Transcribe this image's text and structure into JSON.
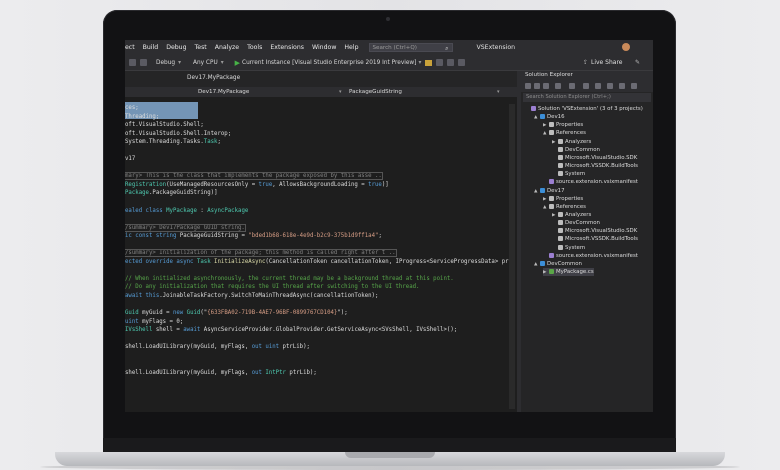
{
  "menu": {
    "items": [
      "ect",
      "Build",
      "Debug",
      "Test",
      "Analyze",
      "Tools",
      "Extensions",
      "Window",
      "Help"
    ],
    "search_placeholder": "Search (Ctrl+Q)",
    "solution_name": "VSExtension"
  },
  "toolbar": {
    "config": "Debug",
    "platform": "Any CPU",
    "run_target": "Current Instance [Visual Studio Enterprise 2019 Int Preview]",
    "live_share": "Live Share"
  },
  "editor": {
    "tab": "Dev17.MyPackage",
    "nav_member": "PackageGuidString",
    "lines": [
      [
        [
          "ces;",
          "id"
        ]
      ],
      [
        [
          "Threading;",
          "id"
        ]
      ],
      [
        [
          "oft.VisualStudio.Shell;",
          "id"
        ]
      ],
      [
        [
          "oft.VisualStudio.Shell.Interop;",
          "id"
        ]
      ],
      [
        [
          "System.Threading.Tasks.",
          "id"
        ],
        [
          "Task",
          "ty"
        ],
        [
          ";",
          "id"
        ]
      ],
      [
        [
          "",
          "id"
        ]
      ],
      [
        [
          "v17",
          "id"
        ]
      ],
      [
        [
          "",
          "id"
        ]
      ],
      [
        [
          "mary> This is the class that implements the package exposed by this asse ..",
          "cs"
        ]
      ],
      [
        [
          "Registration",
          "ty"
        ],
        [
          "(UseManagedResourcesOnly = ",
          "id"
        ],
        [
          "true",
          "kw"
        ],
        [
          ", AllowsBackgroundLoading = ",
          "id"
        ],
        [
          "true",
          "kw"
        ],
        [
          ")]",
          "id"
        ]
      ],
      [
        [
          "Package",
          "ty"
        ],
        [
          ".",
          "id"
        ],
        [
          "PackageGuidString",
          "id"
        ],
        [
          ")]",
          "id"
        ]
      ],
      [
        [
          "",
          "id"
        ]
      ],
      [
        [
          "ealed class ",
          "kw"
        ],
        [
          "MyPackage",
          "ty"
        ],
        [
          " : ",
          "id"
        ],
        [
          "AsyncPackage",
          "ty"
        ]
      ],
      [
        [
          "",
          "id"
        ]
      ],
      [
        [
          "/summary> Dev17Package GUID string.",
          "cs"
        ]
      ],
      [
        [
          "ic const ",
          "kw"
        ],
        [
          "string ",
          "kw"
        ],
        [
          "PackageGuidString",
          "id"
        ],
        [
          " = ",
          "id"
        ],
        [
          "\"bded1b68-618e-4e9d-b2c9-375b1d9ff1a4\"",
          "st"
        ],
        [
          ";",
          "id"
        ]
      ],
      [
        [
          "",
          "id"
        ]
      ],
      [
        [
          "/summary> Initialization of the package; this method is called right after t ..",
          "cs"
        ]
      ],
      [
        [
          "ected override async ",
          "kw"
        ],
        [
          "Task ",
          "ty"
        ],
        [
          "InitializeAsync",
          "fn"
        ],
        [
          "(CancellationToken cancellationToken, IProgress<ServiceProgressData> pr",
          "id"
        ]
      ],
      [
        [
          "",
          "id"
        ]
      ],
      [
        [
          "// When initialized asynchronously, the current thread may be a background thread at this point.",
          "cm"
        ]
      ],
      [
        [
          "// Do any initialization that requires the UI thread after switching to the UI thread.",
          "cm"
        ]
      ],
      [
        [
          "await ",
          "kw"
        ],
        [
          "this",
          "kw"
        ],
        [
          ".JoinableTaskFactory.SwitchToMainThreadAsync(cancellationToken);",
          "id"
        ]
      ],
      [
        [
          "",
          "id"
        ]
      ],
      [
        [
          "Guid ",
          "ty"
        ],
        [
          "myGuid = ",
          "id"
        ],
        [
          "new ",
          "kw"
        ],
        [
          "Guid",
          "ty"
        ],
        [
          "(\"",
          "id"
        ],
        [
          "{633FBA02-719B-4AE7-96BF-0899767CD104}",
          "st"
        ],
        [
          "\");",
          "id"
        ]
      ],
      [
        [
          "uint ",
          "kw"
        ],
        [
          "myFlags = 0;",
          "id"
        ]
      ],
      [
        [
          "IVsShell ",
          "ty"
        ],
        [
          "shell = ",
          "id"
        ],
        [
          "await ",
          "kw"
        ],
        [
          "AsyncServiceProvider.GlobalProvider.GetServiceAsync<SVsShell, IVsShell>();",
          "id"
        ]
      ],
      [
        [
          "",
          "id"
        ]
      ],
      [
        [
          "shell.LoadUILibrary(myGuid, myFlags, ",
          "id"
        ],
        [
          "out ",
          "kw"
        ],
        [
          "uint ",
          "kw"
        ],
        [
          "ptrLib);",
          "id"
        ]
      ],
      [
        [
          "",
          "id"
        ]
      ],
      [
        [
          "",
          "id"
        ]
      ],
      [
        [
          "shell.LoadUILibrary(myGuid, myFlags, ",
          "id"
        ],
        [
          "out ",
          "kw"
        ],
        [
          "IntPtr ",
          "ty"
        ],
        [
          "ptrLib);",
          "id"
        ]
      ]
    ]
  },
  "solution_explorer": {
    "title": "Solution Explorer",
    "search_placeholder": "Search Solution Explorer (Ctrl+;)",
    "nodes": [
      {
        "label": "Solution 'VSExtension' (3 of 3 projects)",
        "indent": 0,
        "arrow": "",
        "icon": "#9b7fd1"
      },
      {
        "label": "Dev16",
        "indent": 1,
        "arrow": "▲",
        "icon": "#3c8fd8"
      },
      {
        "label": "Properties",
        "indent": 2,
        "arrow": "▶",
        "icon": "#bdbdbd"
      },
      {
        "label": "References",
        "indent": 2,
        "arrow": "▲",
        "icon": "#bdbdbd"
      },
      {
        "label": "Analyzers",
        "indent": 3,
        "arrow": "▶",
        "icon": "#bdbdbd"
      },
      {
        "label": "DevCommon",
        "indent": 3,
        "arrow": "",
        "icon": "#bdbdbd"
      },
      {
        "label": "Microsoft.VisualStudio.SDK",
        "indent": 3,
        "arrow": "",
        "icon": "#bdbdbd"
      },
      {
        "label": "Microsoft.VSSDK.BuildTools",
        "indent": 3,
        "arrow": "",
        "icon": "#bdbdbd"
      },
      {
        "label": "System",
        "indent": 3,
        "arrow": "",
        "icon": "#bdbdbd"
      },
      {
        "label": "source.extension.vsixmanifest",
        "indent": 2,
        "arrow": "",
        "icon": "#9b7fd1"
      },
      {
        "label": "Dev17",
        "indent": 1,
        "arrow": "▲",
        "icon": "#3c8fd8"
      },
      {
        "label": "Properties",
        "indent": 2,
        "arrow": "▶",
        "icon": "#bdbdbd"
      },
      {
        "label": "References",
        "indent": 2,
        "arrow": "▲",
        "icon": "#bdbdbd"
      },
      {
        "label": "Analyzers",
        "indent": 3,
        "arrow": "▶",
        "icon": "#bdbdbd"
      },
      {
        "label": "DevCommon",
        "indent": 3,
        "arrow": "",
        "icon": "#bdbdbd"
      },
      {
        "label": "Microsoft.VisualStudio.SDK",
        "indent": 3,
        "arrow": "",
        "icon": "#bdbdbd"
      },
      {
        "label": "Microsoft.VSSDK.BuildTools",
        "indent": 3,
        "arrow": "",
        "icon": "#bdbdbd"
      },
      {
        "label": "System",
        "indent": 3,
        "arrow": "",
        "icon": "#bdbdbd"
      },
      {
        "label": "source.extension.vsixmanifest",
        "indent": 2,
        "arrow": "",
        "icon": "#9b7fd1"
      },
      {
        "label": "DevCommon",
        "indent": 1,
        "arrow": "▲",
        "icon": "#3c8fd8"
      },
      {
        "label": "MyPackage.cs",
        "indent": 2,
        "arrow": "▶",
        "icon": "#5aa647"
      }
    ]
  },
  "colors": {
    "accent": "#007acc",
    "editor_bg": "#1e1e1e",
    "panel_bg": "#252526"
  }
}
